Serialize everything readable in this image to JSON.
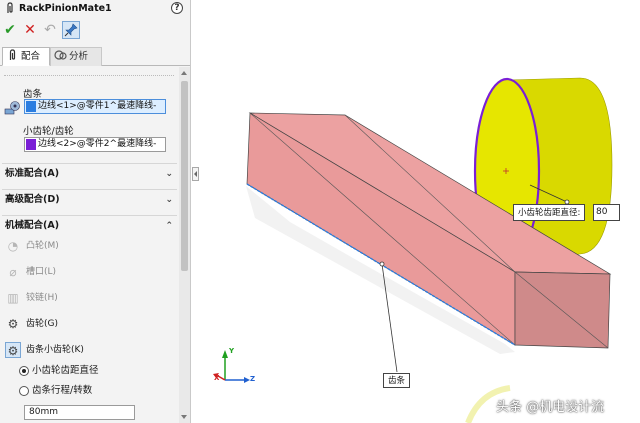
{
  "property_manager": {
    "title": "RackPinionMate1",
    "help_symbol": "?",
    "tabs": [
      {
        "label": "配合",
        "icon": "paperclip-icon"
      },
      {
        "label": "分析",
        "icon": "analysis-icon"
      }
    ],
    "selections": {
      "rack_label": "齿条",
      "rack_value": "边线<1>@零件1^最速降线-",
      "rack_swatch_color": "#2b7de0",
      "pinion_label": "小齿轮/齿轮",
      "pinion_value": "边线<2>@零件2^最速降线-",
      "pinion_swatch_color": "#7a1fd6"
    },
    "sections": [
      {
        "label": "标准配合(A)",
        "state": "collapsed"
      },
      {
        "label": "高级配合(D)",
        "state": "collapsed"
      },
      {
        "label": "机械配合(A)",
        "state": "expanded"
      }
    ],
    "mechanical_mates": [
      {
        "label": "凸轮(M)",
        "icon": "cam-icon",
        "enabled": false
      },
      {
        "label": "槽口(L)",
        "icon": "slot-icon",
        "enabled": false
      },
      {
        "label": "铰链(H)",
        "icon": "hinge-icon",
        "enabled": false
      },
      {
        "label": "齿轮(G)",
        "icon": "gear-icon",
        "enabled": true
      },
      {
        "label": "齿条小齿轮(K)",
        "icon": "rack-pinion-icon",
        "enabled": true,
        "selected": true
      }
    ],
    "options": [
      {
        "label": "小齿轮齿距直径",
        "checked": true
      },
      {
        "label": "齿条行程/转数",
        "checked": false
      }
    ],
    "value_field": "80mm"
  },
  "viewport": {
    "pitch_diameter_label": "小齿轮齿距直径:",
    "pitch_diameter_value": "80",
    "rack_callout": "齿条",
    "triad_axes": [
      "Y",
      "X",
      "Z"
    ],
    "watermark": "头条 @机电设计流",
    "colors": {
      "rack_face": "#e99a9a",
      "pinion_face": "#e6e600",
      "pinion_edge": "#7a1fd6",
      "rack_edge": "#2b7de0"
    }
  }
}
